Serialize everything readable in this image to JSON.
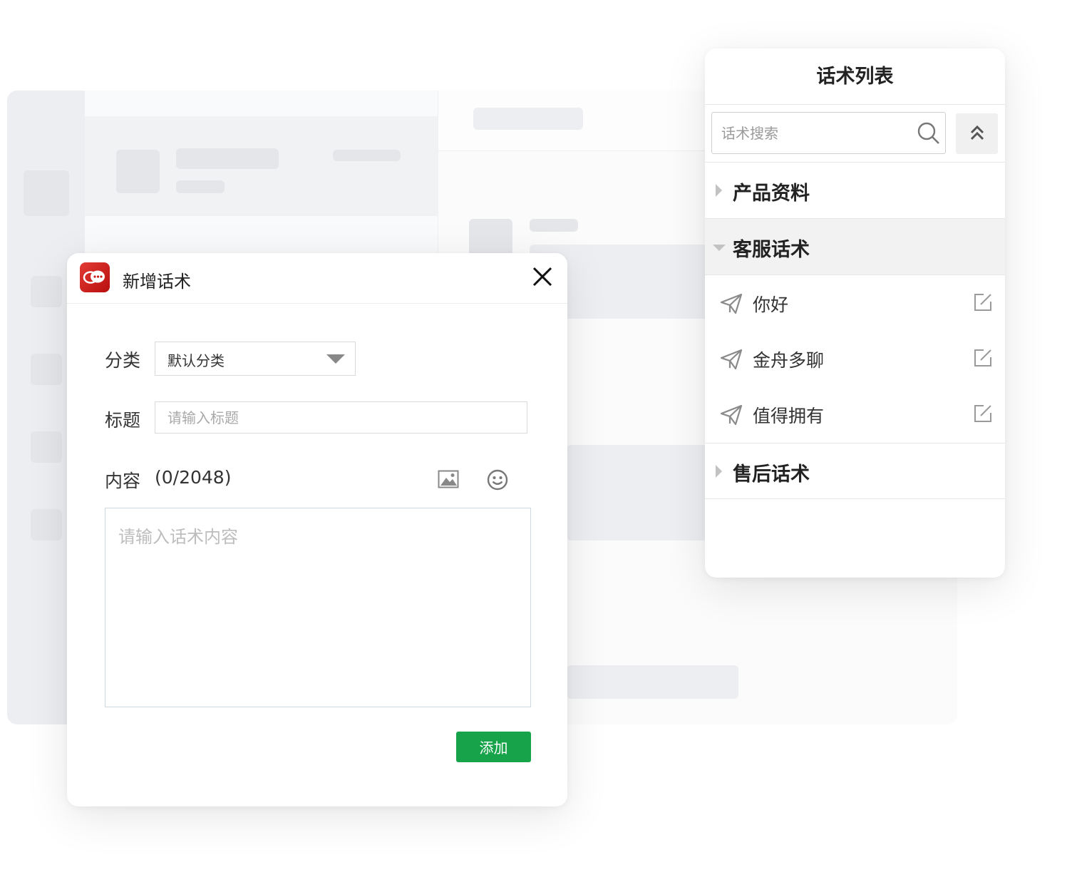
{
  "dialog": {
    "title": "新增话术",
    "category_label": "分类",
    "category_value": "默认分类",
    "title_label": "标题",
    "title_placeholder": "请输入标题",
    "content_label": "内容",
    "content_count": "(0/2048)",
    "content_placeholder": "请输入话术内容",
    "add_button": "添加",
    "accent_color": "#17a34a"
  },
  "list_panel": {
    "title": "话术列表",
    "search_placeholder": "话术搜索",
    "categories": [
      {
        "label": "产品资料",
        "expanded": false
      },
      {
        "label": "客服话术",
        "expanded": true,
        "items": [
          "你好",
          "金舟多聊",
          "值得拥有"
        ]
      },
      {
        "label": "售后话术",
        "expanded": false
      }
    ]
  }
}
